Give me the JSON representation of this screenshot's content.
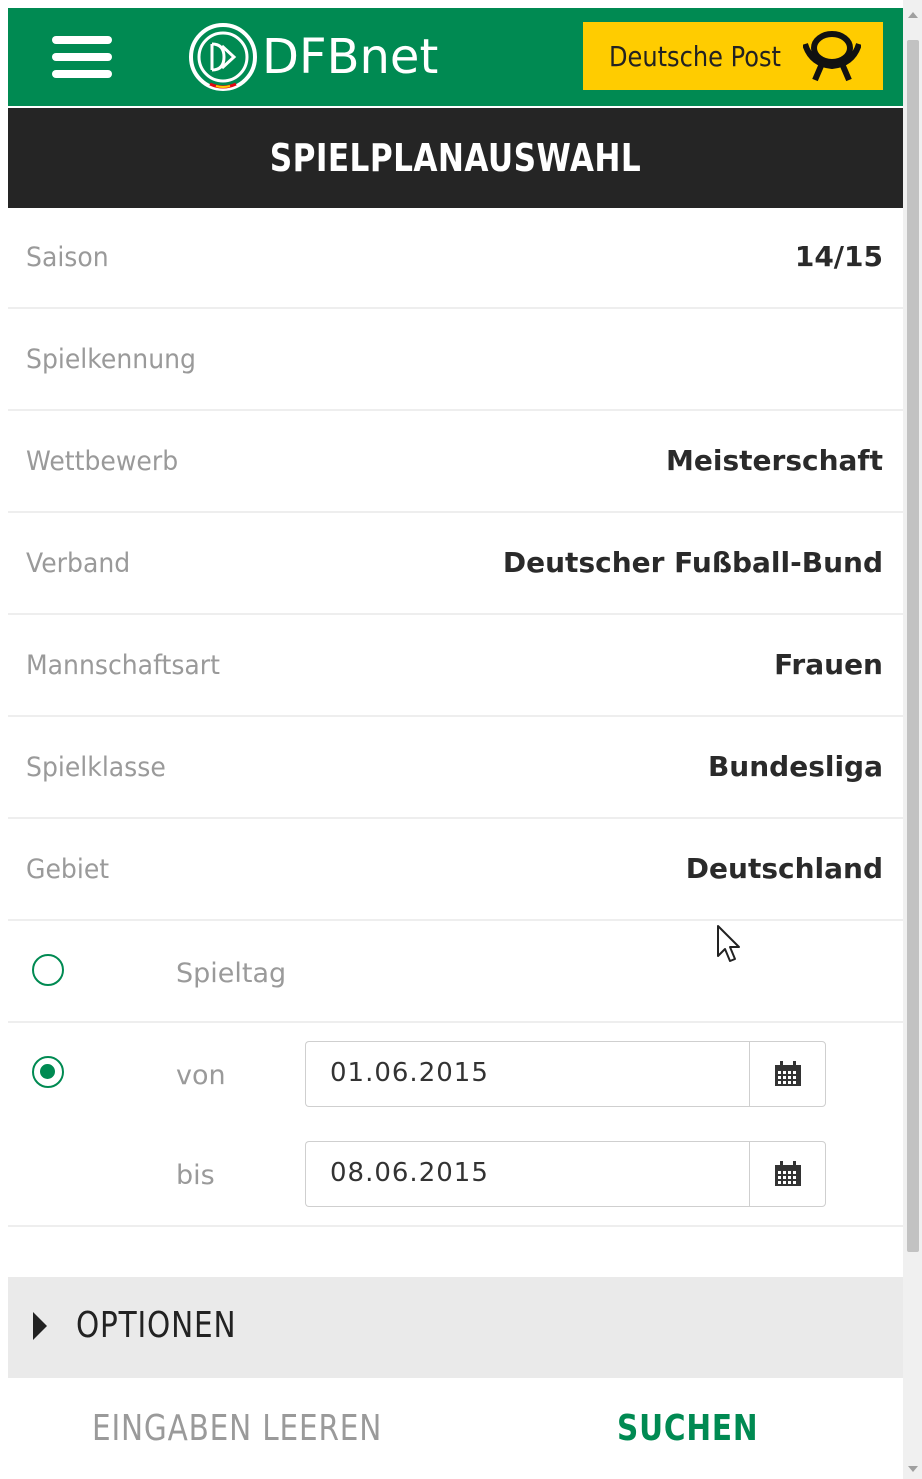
{
  "header": {
    "logo_text": "DFBnet",
    "sponsor_text": "Deutsche Post",
    "title": "SPIELPLANAUSWAHL"
  },
  "fields": [
    {
      "label": "Saison",
      "value": "14/15"
    },
    {
      "label": "Spielkennung",
      "value": ""
    },
    {
      "label": "Wettbewerb",
      "value": "Meisterschaft"
    },
    {
      "label": "Verband",
      "value": "Deutscher Fußball-Bund"
    },
    {
      "label": "Mannschaftsart",
      "value": "Frauen"
    },
    {
      "label": "Spielklasse",
      "value": "Bundesliga"
    },
    {
      "label": "Gebiet",
      "value": "Deutschland"
    }
  ],
  "mode": {
    "spieltag_label": "Spieltag",
    "spieltag_selected": false,
    "range_selected": true,
    "von_label": "von",
    "von_value": "01.06.2015",
    "bis_label": "bis",
    "bis_value": "08.06.2015"
  },
  "options_label": "OPTIONEN",
  "actions": {
    "clear_label": "EINGABEN LEEREN",
    "search_label": "SUCHEN"
  },
  "colors": {
    "brand_green": "#008a52",
    "title_bar": "#252525",
    "sponsor_yellow": "#ffcc00"
  },
  "icons": [
    "menu-icon",
    "dfb-logo-icon",
    "post-horn-icon",
    "calendar-icon",
    "caret-right-icon",
    "mouse-cursor-icon"
  ]
}
